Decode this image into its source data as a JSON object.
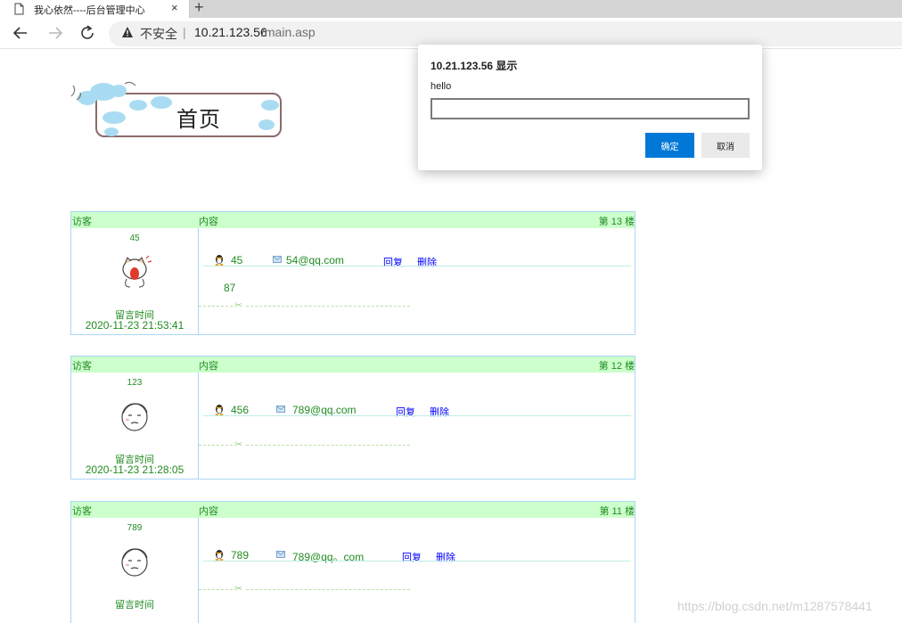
{
  "browser": {
    "tab_title": "我心依然----后台管理中心",
    "tab_close": "×",
    "new_tab": "+",
    "security_label": "不安全",
    "address_separator": "|",
    "url_host": "10.21.123.56",
    "url_path": "/main.asp"
  },
  "page": {
    "banner_text": "首页",
    "labels": {
      "visitor": "访客",
      "content": "内容",
      "time": "留言时间",
      "reply": "回复",
      "delete": "删除"
    },
    "messages": [
      {
        "floor": "第 13 楼",
        "visitor": "45",
        "time": "2020-11-23 21:53:41",
        "qq": "45",
        "email": "54@qq.com",
        "content": "87"
      },
      {
        "floor": "第 12 楼",
        "visitor": "123",
        "time": "2020-11-23 21:28:05",
        "qq": "456",
        "email": "789@qq.com",
        "content": ""
      },
      {
        "floor": "第 11 楼",
        "visitor": "789",
        "time": "",
        "qq": "789",
        "email": "789@qq。com",
        "content": ""
      }
    ]
  },
  "dialog": {
    "title": "10.21.123.56 显示",
    "message": "hello",
    "input_value": "",
    "ok_label": "确定",
    "cancel_label": "取消"
  },
  "watermark": "https://blog.csdn.net/m1287578441",
  "colors": {
    "header_bg": "#ccffcc",
    "text_green": "#228b22",
    "link_blue": "#0000ff",
    "border_blue": "#a9d6f5",
    "ok_button": "#0078d7"
  }
}
